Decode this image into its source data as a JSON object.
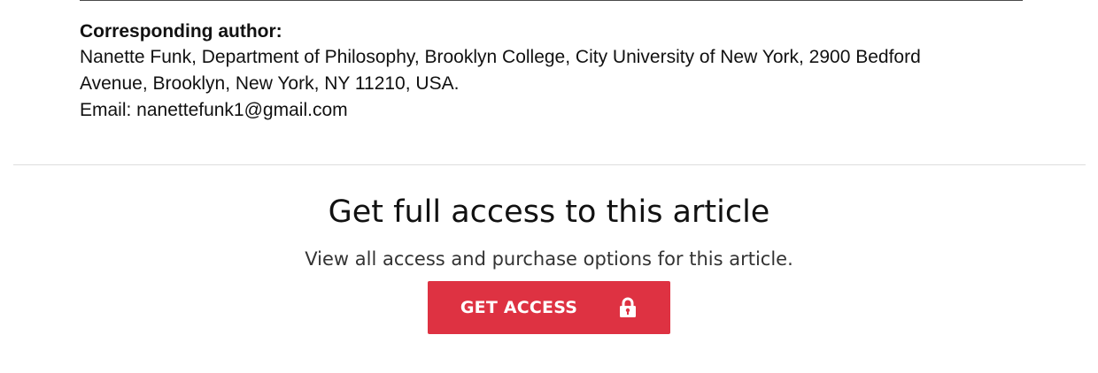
{
  "author": {
    "heading": "Corresponding author:",
    "lines": [
      "Nanette Funk, Department of Philosophy, Brooklyn College, City University of New York, 2900 Bedford",
      "Avenue, Brooklyn, New York, NY 11210, USA.",
      "Email: nanettefunk1@gmail.com"
    ]
  },
  "access": {
    "title": "Get full access to this article",
    "subtitle": "View all access and purchase options for this article.",
    "button_label": "GET ACCESS",
    "button_icon": "lock-icon",
    "button_color": "#de3242"
  }
}
